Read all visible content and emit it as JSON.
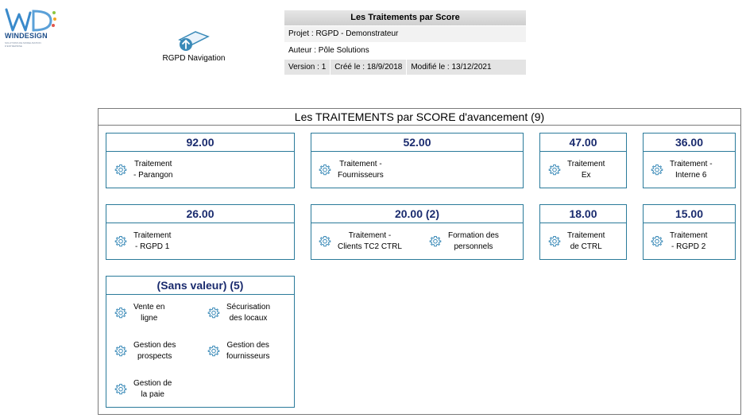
{
  "logo": {
    "brand_win": "WIN",
    "brand_design": "DESIGN",
    "tagline": "SOLUTIONS DE MODELISATION D'ENTREPRISE"
  },
  "navigation": {
    "label": "RGPD Navigation"
  },
  "header": {
    "title": "Les Traitements par Score",
    "project": "Projet : RGPD - Demonstrateur",
    "author": "Auteur : Pôle Solutions",
    "version": "Version : 1",
    "created": "Créé le : 18/9/2018",
    "modified": "Modifié le : 13/12/2021"
  },
  "panel": {
    "title": "Les TRAITEMENTS par SCORE d'avancement (9)",
    "cards": [
      {
        "score": "92.00",
        "items": [
          "Traitement\n- Parangon"
        ]
      },
      {
        "score": "52.00",
        "items": [
          "Traitement -\nFournisseurs"
        ]
      },
      {
        "score": "47.00",
        "items": [
          "Traitement\nEx"
        ]
      },
      {
        "score": "36.00",
        "items": [
          "Traitement -\nInterne 6"
        ]
      },
      {
        "score": "26.00",
        "items": [
          "Traitement\n- RGPD 1"
        ]
      },
      {
        "score": "20.00 (2)",
        "items": [
          "Traitement -\nClients TC2 CTRL",
          "Formation des\npersonnels"
        ]
      },
      {
        "score": "18.00",
        "items": [
          "Traitement\nde CTRL"
        ]
      },
      {
        "score": "15.00",
        "items": [
          "Traitement\n- RGPD 2"
        ]
      },
      {
        "score": "(Sans valeur) (5)",
        "items": [
          "Vente en\nligne",
          "Sécurisation\ndes locaux",
          "Gestion des\nprospects",
          "Gestion des\nfournisseurs",
          "Gestion de\nla paie"
        ]
      }
    ]
  },
  "colors": {
    "score_text": "#1a2b6e",
    "card_border": "#2a7a9a",
    "gear": "#3a8ab8"
  },
  "icons": {
    "item": "gear-icon",
    "navigation": "navigation-icon",
    "logo": "windesign-logo"
  }
}
